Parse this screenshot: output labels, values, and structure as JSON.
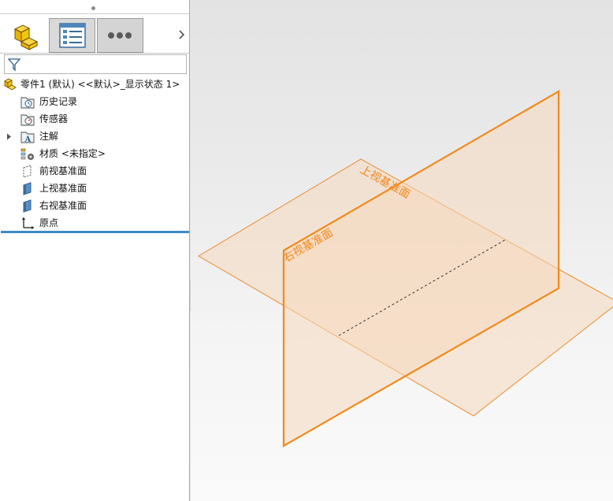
{
  "colors": {
    "accent": "#f08a1c",
    "plane_fill": "#f6d9bd",
    "selection_bar": "#3c8ac7",
    "plane_frame": "#e8821a"
  },
  "tabs": [
    {
      "name": "featuremanager-tab",
      "icon": "part-cubes-icon"
    },
    {
      "name": "propertymanager-tab",
      "icon": "property-list-icon"
    },
    {
      "name": "more-tab",
      "icon": "ellipsis-icon"
    }
  ],
  "filter": {
    "icon": "filter-funnel-icon"
  },
  "tree": {
    "root": {
      "label": "零件1 (默认) <<默认>_显示状态 1>",
      "icon": "part-icon"
    },
    "items": [
      {
        "label": "历史记录",
        "icon": "history-folder-icon"
      },
      {
        "label": "传感器",
        "icon": "sensor-folder-icon"
      },
      {
        "label": "注解",
        "icon": "annotation-folder-icon",
        "expandable": true
      },
      {
        "label": "材质 <未指定>",
        "icon": "material-icon"
      },
      {
        "label": "前视基准面",
        "icon": "front-plane-icon"
      },
      {
        "label": "上视基准面",
        "icon": "top-plane-icon"
      },
      {
        "label": "右视基准面",
        "icon": "right-plane-icon"
      },
      {
        "label": "原点",
        "icon": "origin-icon"
      }
    ]
  },
  "viewport": {
    "top_plane_label": "上视基准面",
    "right_plane_label": "右视基准面"
  }
}
